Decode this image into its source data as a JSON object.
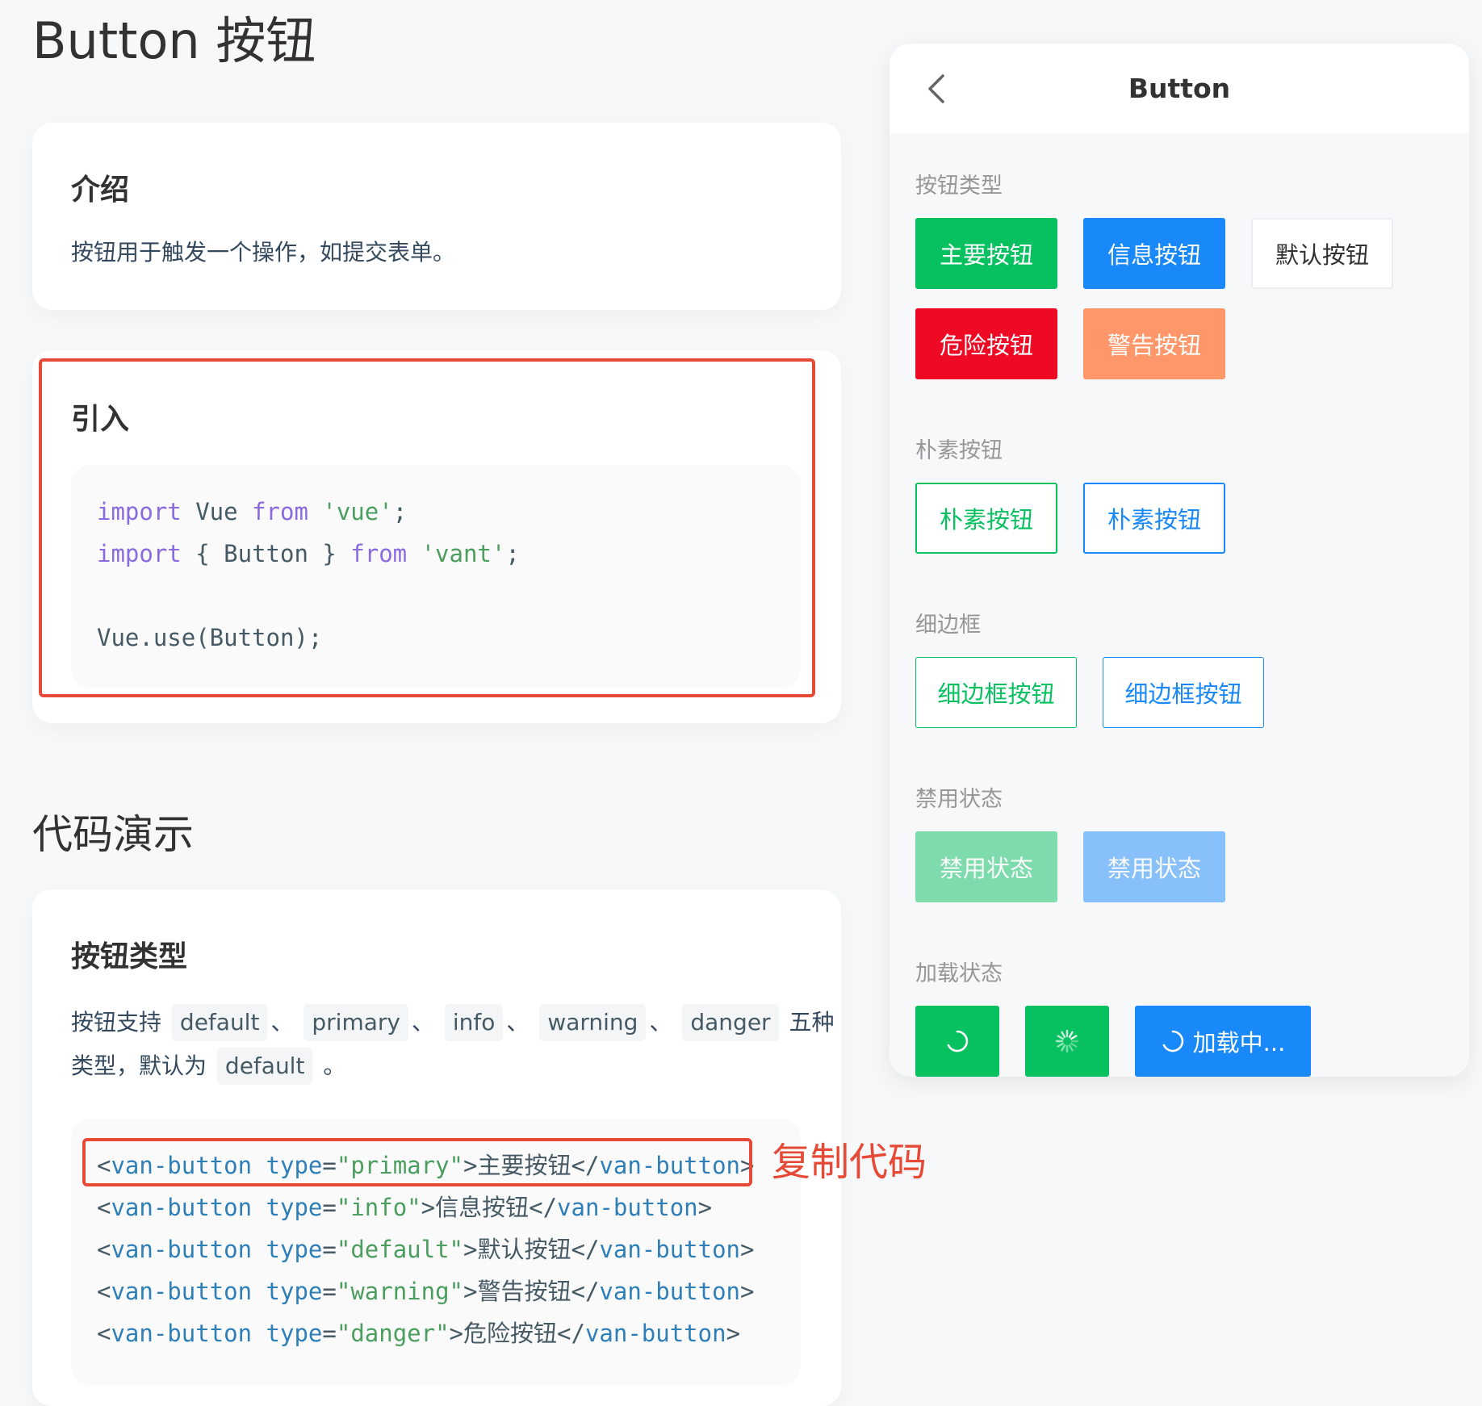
{
  "page_title": "Button 按钮",
  "intro": {
    "title": "介绍",
    "text": "按钮用于触发一个操作，如提交表单。"
  },
  "import_section": {
    "title": "引入",
    "code": {
      "line1": {
        "kw1": "import",
        "mid": " Vue ",
        "kw2": "from",
        "sp": " ",
        "str": "'vue'",
        "end": ";"
      },
      "line2": {
        "kw1": "import",
        "mid": " { Button } ",
        "kw2": "from",
        "sp": " ",
        "str": "'vant'",
        "end": ";"
      },
      "line3": "Vue.use(Button);"
    }
  },
  "demo_title": "代码演示",
  "button_types": {
    "title": "按钮类型",
    "desc_prefix": "按钮支持",
    "types": [
      "default",
      "primary",
      "info",
      "warning",
      "danger"
    ],
    "sep": "、",
    "desc_suffix": "五种",
    "desc2_prefix": "类型，默认为",
    "default_type": "default",
    "desc2_end": "。",
    "code_lines": [
      {
        "open": "<",
        "tag": "van-button",
        "attr": "type",
        "eq": "=",
        "val": "\"primary\"",
        "gt": ">",
        "text": "主要按钮",
        "close_lt": "</",
        "close_tag": "van-button",
        "close_gt": ">"
      },
      {
        "open": "<",
        "tag": "van-button",
        "attr": "type",
        "eq": "=",
        "val": "\"info\"",
        "gt": ">",
        "text": "信息按钮",
        "close_lt": "</",
        "close_tag": "van-button",
        "close_gt": ">"
      },
      {
        "open": "<",
        "tag": "van-button",
        "attr": "type",
        "eq": "=",
        "val": "\"default\"",
        "gt": ">",
        "text": "默认按钮",
        "close_lt": "</",
        "close_tag": "van-button",
        "close_gt": ">"
      },
      {
        "open": "<",
        "tag": "van-button",
        "attr": "type",
        "eq": "=",
        "val": "\"warning\"",
        "gt": ">",
        "text": "警告按钮",
        "close_lt": "</",
        "close_tag": "van-button",
        "close_gt": ">"
      },
      {
        "open": "<",
        "tag": "van-button",
        "attr": "type",
        "eq": "=",
        "val": "\"danger\"",
        "gt": ">",
        "text": "危险按钮",
        "close_lt": "</",
        "close_tag": "van-button",
        "close_gt": ">"
      }
    ]
  },
  "annotation": "复制代码",
  "preview": {
    "nav_title": "Button",
    "sections": {
      "types": "按钮类型",
      "plain": "朴素按钮",
      "hairline": "细边框",
      "disabled": "禁用状态",
      "loading": "加载状态"
    },
    "buttons": {
      "primary": "主要按钮",
      "info": "信息按钮",
      "default": "默认按钮",
      "danger": "危险按钮",
      "warning": "警告按钮",
      "plain_primary": "朴素按钮",
      "plain_info": "朴素按钮",
      "hairline_primary": "细边框按钮",
      "hairline_info": "细边框按钮",
      "disabled_primary": "禁用状态",
      "disabled_info": "禁用状态",
      "loading_text": "加载中..."
    }
  },
  "colors": {
    "primary": "#07c160",
    "info": "#1989fa",
    "danger": "#ee0a24",
    "warning": "#ff976a",
    "highlight": "#e64a36"
  }
}
